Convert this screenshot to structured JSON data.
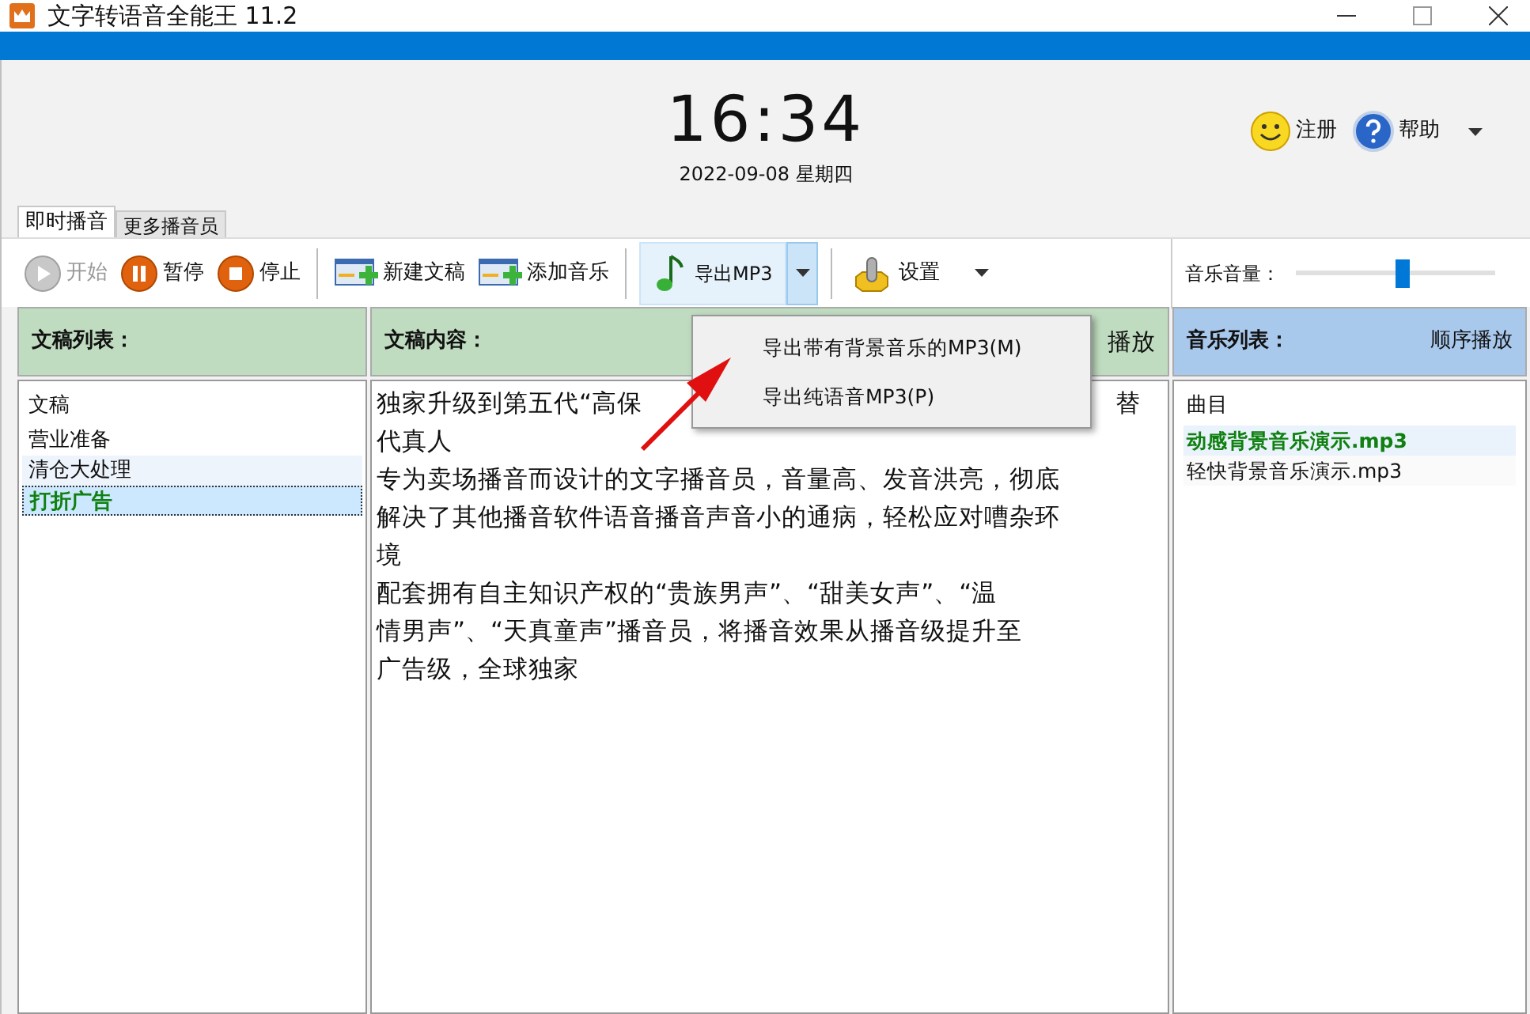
{
  "window": {
    "title": "文字转语音全能王 11.2"
  },
  "clock": {
    "time": "16:34",
    "date": "2022-09-08 星期四"
  },
  "header_links": [
    {
      "label": "注册",
      "kind": "smile"
    },
    {
      "label": "帮助",
      "kind": "help"
    }
  ],
  "tabs": [
    {
      "label": "即时播音",
      "selected": true
    },
    {
      "label": "更多播音员",
      "selected": false
    }
  ],
  "toolbar": [
    {
      "label": "开始",
      "kind": "play",
      "disabled": true
    },
    {
      "label": "暂停",
      "kind": "pause",
      "disabled": false
    },
    {
      "label": "停止",
      "kind": "stop",
      "disabled": false
    },
    {
      "kind": "separator"
    },
    {
      "label": "新建文稿",
      "kind": "add"
    },
    {
      "label": "添加音乐",
      "kind": "add"
    },
    {
      "kind": "separator"
    },
    {
      "label": "导出MP3",
      "kind": "export"
    },
    {
      "kind": "separator"
    },
    {
      "label": "设置",
      "kind": "settings"
    }
  ],
  "volume": {
    "label": "音乐音量：",
    "level": 0.53
  },
  "export_menu": {
    "items": [
      "导出带有背景音乐的MP3(M)",
      "导出纯语音MP3(P)"
    ]
  },
  "script_list": {
    "title": "文稿列表：",
    "column": "文稿",
    "items": [
      {
        "label": "营业准备",
        "selected": false
      },
      {
        "label": "清仓大处理",
        "selected": false
      },
      {
        "label": "打折广告",
        "selected": true
      }
    ]
  },
  "script_content": {
    "title": "文稿内容：",
    "action": "播放",
    "first_line_start": "独家升级到第五代“高保",
    "first_line_end": "替",
    "lines": [
      "代真人",
      "专为卖场播音而设计的文字播音员，音量高、发音洪亮，彻底",
      "解决了其他播音软件语音播音声音小的通病，轻松应对嘈杂环",
      "境",
      "配套拥有自主知识产权的“贵族男声”、“甜美女声”、“温",
      "情男声”、“天真童声”播音员，将播音效果从播音级提升至",
      "广告级，全球独家"
    ]
  },
  "music_list": {
    "title": "音乐列表：",
    "mode": "顺序播放",
    "column": "曲目",
    "items": [
      {
        "label": "动感背景音乐演示.mp3",
        "selected": true
      },
      {
        "label": "轻快背景音乐演示.mp3",
        "selected": false
      }
    ]
  }
}
